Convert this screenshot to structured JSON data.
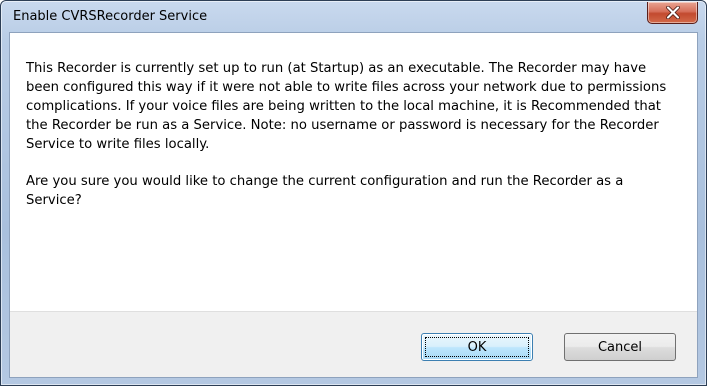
{
  "window": {
    "title": "Enable CVRSRecorder Service"
  },
  "message": {
    "paragraph1": "This Recorder is currently set up to run (at Startup) as an executable.  The Recorder may have been configured this way if it were not able to write files across your network due to permissions complications.  If your voice files are being written to the local machine, it is Recommended that the Recorder be run as a Service.  Note: no username or password is necessary for the Recorder Service to write files locally.",
    "paragraph2": "Are you sure you would like to change the current configuration and run the Recorder as a Service?"
  },
  "buttons": {
    "ok_label": "OK",
    "cancel_label": "Cancel"
  },
  "icons": {
    "close": "close-icon"
  },
  "colors": {
    "close_button": "#c24a2f",
    "title_bar": "#b9cde6",
    "button_bar": "#f0f0f0",
    "default_button_border": "#3c7fb1"
  }
}
